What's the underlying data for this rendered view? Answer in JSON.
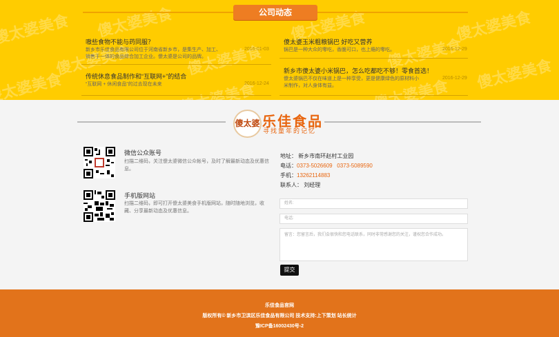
{
  "news": {
    "watermark": "傻太婆美食",
    "section_title": "公司动态",
    "items": [
      {
        "title": "嗷些食物不能与药同服？",
        "desc": "新乡市乐佳食品有限公司位于河南省新乡市，是集生产、加工、\n销售于一体的食品综合加工企业。傻太婆是公司的品牌。",
        "date": "2016-01-03"
      },
      {
        "title": "傻太婆玉米粗粮锅巴 好吃又营养",
        "desc": "锅巴是一种大众的零吃，香脆可口，也上瘾的零吃。",
        "date": "2016-12-29"
      },
      {
        "title": "传统休息食品制作和“互联网+”的结合",
        "desc": "“互联网 + 休闲食品”的过去现在未来",
        "date": "2016-12-24"
      },
      {
        "title": "新乡市傻太婆小米锅巴，怎么吃都吃不够！零食首选！",
        "desc": "傻太婆锅巴不仅在味道上是一种享受，更是健康绿色的原材料小\n米制作，对人身体有益。",
        "date": "2016-12-29"
      }
    ]
  },
  "brand": {
    "badge": "傻太婆",
    "name": "乐佳食品",
    "slogan": "寻找童年的记忆"
  },
  "qr": [
    {
      "title": "微信公众账号",
      "desc": "扫描二维码，关注傻太婆微信公众帐号，及时了解最新动态及优惠信息。"
    },
    {
      "title": "手机版网站",
      "desc": "扫描二维码，即可打开傻太婆美食手机版网站，随时随地浏览，收藏、分享最新动态及优惠信息。"
    }
  ],
  "contact": {
    "address_label": "地址：",
    "address": "新乡市南环赵村工业园",
    "phone_label": "电话：",
    "phone": "0373-5026609   0373-5089590",
    "mobile_label": "手机：",
    "mobile": "13262114883",
    "person_label": "联系人：",
    "person": "刘经理"
  },
  "form": {
    "name_placeholder": "姓名:",
    "phone_placeholder": "电话:",
    "message_placeholder": "留言：您留言后，我们会很快和您电话联系，同时非常感谢您的关注，谨祝您合作成功。",
    "submit": "提交"
  },
  "footer": {
    "line1": "乐佳食品官网",
    "line2": "版权所有© 新乡市卫滨区乐佳食品有限公司 技术支持:上下策划 站长统计",
    "line3": "豫ICP备16002430号-2"
  },
  "colors": {
    "news_bg": "#ffcc00",
    "accent": "#ee7d22",
    "footer_bg": "#e2731b"
  }
}
